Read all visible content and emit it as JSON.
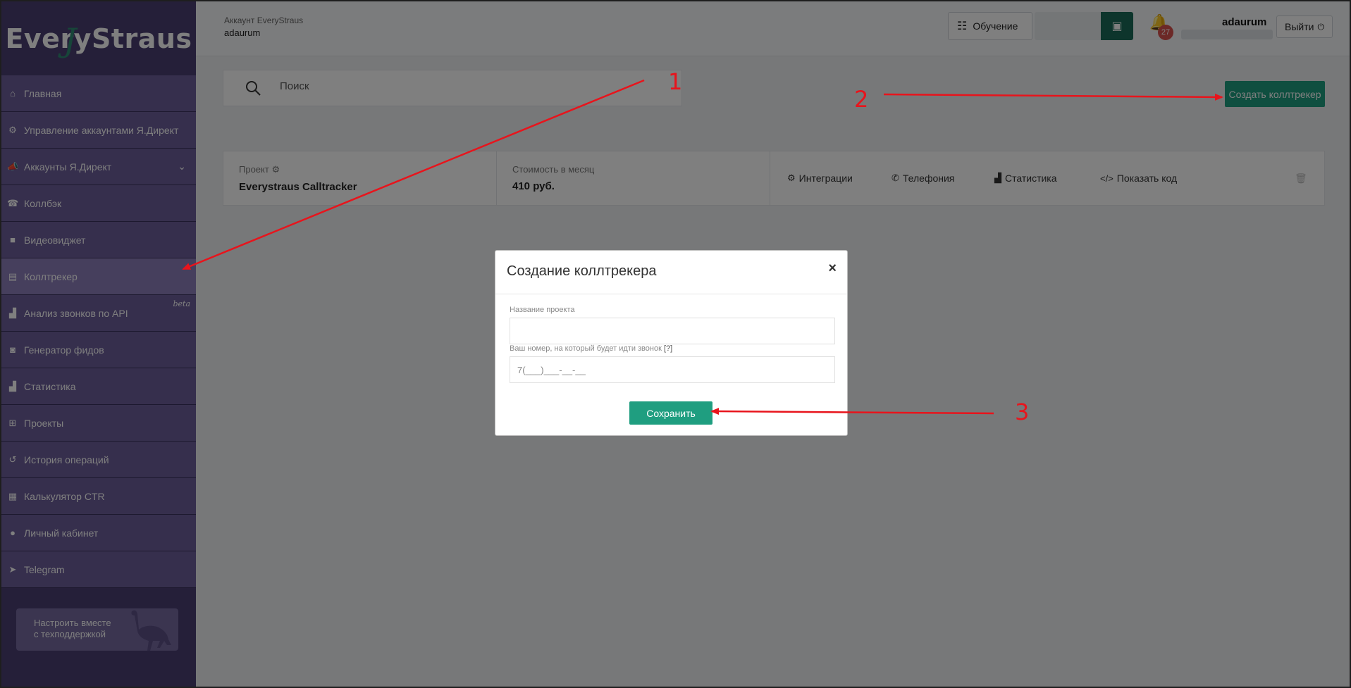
{
  "logo": {
    "text": "EveryStraus",
    "mark": "J"
  },
  "sidebar": {
    "items": [
      {
        "label": "Главная",
        "icon": "home-icon",
        "glyph": "⌂"
      },
      {
        "label": "Управление аккаунтами Я.Директ",
        "icon": "gears-icon",
        "glyph": "⚙"
      },
      {
        "label": "Аккаунты Я.Директ",
        "icon": "bullhorn-icon",
        "glyph": "📣"
      },
      {
        "label": "Коллбэк",
        "icon": "phone-square-icon",
        "glyph": "☎"
      },
      {
        "label": "Видеовиджет",
        "icon": "video-camera-icon",
        "glyph": "■"
      },
      {
        "label": "Коллтрекер",
        "icon": "file-icon",
        "glyph": "▤"
      },
      {
        "label": "Анализ звонков по API",
        "icon": "bar-chart-icon",
        "glyph": "▟",
        "tag": "beta"
      },
      {
        "label": "Генератор фидов",
        "icon": "rss-icon",
        "glyph": "◙"
      },
      {
        "label": "Статистика",
        "icon": "area-chart-icon",
        "glyph": "▟"
      },
      {
        "label": "Проекты",
        "icon": "sitemap-icon",
        "glyph": "⊞"
      },
      {
        "label": "История операций",
        "icon": "history-icon",
        "glyph": "↺"
      },
      {
        "label": "Калькулятор CTR",
        "icon": "calculator-icon",
        "glyph": "▦"
      },
      {
        "label": "Личный кабинет",
        "icon": "user-icon",
        "glyph": "●"
      },
      {
        "label": "Telegram",
        "icon": "telegram-icon",
        "glyph": "➤"
      }
    ],
    "help_line1": "Настроить вместе",
    "help_line2": "с техподдержкой"
  },
  "topbar": {
    "account_label": "Аккаунт EveryStraus",
    "account_name": "adaurum",
    "learn_label": "Обучение",
    "notifications_count": "27",
    "user_name": "adaurum",
    "logout_label": "Выйти"
  },
  "search": {
    "placeholder": "Поиск"
  },
  "create_button": "Создать коллтрекер",
  "project_card": {
    "project_label": "Проект",
    "project_name": "Everystraus Calltracker",
    "cost_label": "Стоимость в месяц",
    "cost_value": "410 руб.",
    "actions": {
      "integrations": "Интеграции",
      "telephony": "Телефония",
      "statistics": "Статистика",
      "show_code": "Показать код"
    }
  },
  "modal": {
    "title": "Создание коллтрекера",
    "close": "×",
    "project_name_label": "Название проекта",
    "project_name_value": "",
    "phone_label": "Ваш номер, на который будет идти звонок",
    "phone_hint": "[?]",
    "phone_value": "7(___)___-__-__",
    "save_label": "Сохранить"
  },
  "annotations": {
    "step1": "1",
    "step2": "2",
    "step3": "3",
    "color": "#e8141c"
  },
  "colors": {
    "sidebar": "#4a3f73",
    "nav_item": "#6d5f9a",
    "nav_active": "#8d7fba",
    "accent": "#1f9e80"
  }
}
